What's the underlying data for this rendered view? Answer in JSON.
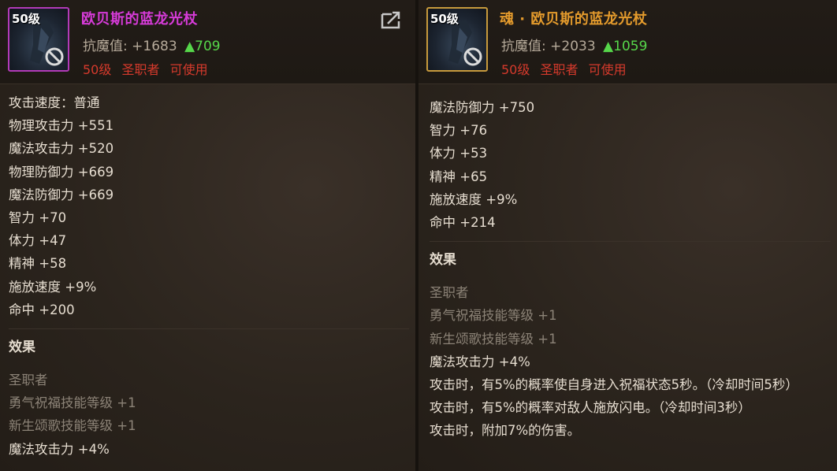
{
  "left": {
    "level": "50级",
    "name": "欧贝斯的蓝龙光杖",
    "resist_label": "抗魔值:",
    "resist_value": "+1683",
    "resist_bonus": "▲709",
    "req_level": "50级",
    "req_class": "圣职者",
    "req_usable": "可使用",
    "stats": [
      "攻击速度：普通",
      "物理攻击力 +551",
      "魔法攻击力 +520",
      "物理防御力 +669",
      "魔法防御力 +669",
      "智力 +70",
      "体力 +47",
      "精神 +58",
      "施放速度 +9%",
      "命中 +200"
    ],
    "effects_title": "效果",
    "effects": [
      {
        "text": "圣职者",
        "tone": "dim"
      },
      {
        "text": "勇气祝福技能等级 +1",
        "tone": "dim"
      },
      {
        "text": "新生颂歌技能等级 +1",
        "tone": "dim"
      },
      {
        "text": "魔法攻击力 +4%",
        "tone": "bright"
      }
    ]
  },
  "right": {
    "level": "50级",
    "name": "魂 · 欧贝斯的蓝龙光杖",
    "resist_label": "抗魔值:",
    "resist_value": "+2033",
    "resist_bonus": "▲1059",
    "req_level": "50级",
    "req_class": "圣职者",
    "req_usable": "可使用",
    "stats": [
      "魔法防御力 +750",
      "智力 +76",
      "体力 +53",
      "精神 +65",
      "施放速度 +9%",
      "命中 +214"
    ],
    "effects_title": "效果",
    "effects": [
      {
        "text": "圣职者",
        "tone": "dim"
      },
      {
        "text": "勇气祝福技能等级 +1",
        "tone": "dim"
      },
      {
        "text": "新生颂歌技能等级 +1",
        "tone": "dim"
      },
      {
        "text": "魔法攻击力 +4%",
        "tone": "bright"
      },
      {
        "text": "攻击时，有5%的概率使自身进入祝福状态5秒。（冷却时间5秒）",
        "tone": "bright"
      },
      {
        "text": "攻击时，有5%的概率对敌人施放闪电。（冷却时间3秒）",
        "tone": "bright"
      },
      {
        "text": "攻击时，附加7%的伤害。",
        "tone": "bright"
      }
    ]
  },
  "colors": {
    "name_left": "#d63bd8",
    "name_right": "#e39a2c",
    "bonus_green": "#56d64a",
    "requirement_red": "#d63a2c"
  },
  "icons": {
    "item": "staff-item-icon",
    "restricted": "ban-icon",
    "share": "share-icon"
  }
}
